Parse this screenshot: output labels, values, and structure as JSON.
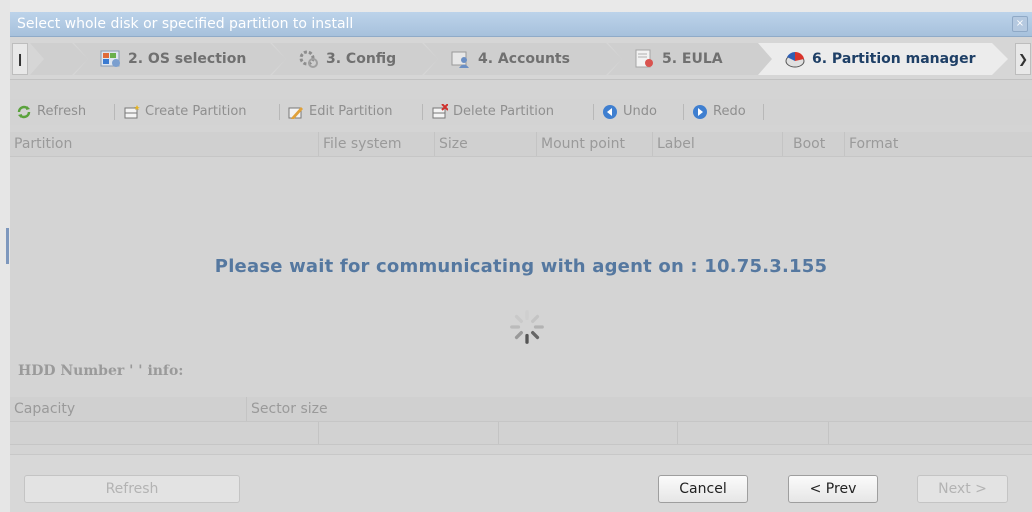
{
  "dialog": {
    "title": "Select whole disk or specified partition to install",
    "close_label": "×"
  },
  "steps": [
    {
      "label": "2. OS selection",
      "icon": "os-selection-icon",
      "active": false
    },
    {
      "label": "3. Config",
      "icon": "config-gear-icon",
      "active": false
    },
    {
      "label": "4. Accounts",
      "icon": "accounts-icon",
      "active": false
    },
    {
      "label": "5. EULA",
      "icon": "eula-certificate-icon",
      "active": false
    },
    {
      "label": "6. Partition manager",
      "icon": "partition-disk-icon",
      "active": true
    }
  ],
  "steps_partial_label": "",
  "toolbar": {
    "refresh": "Refresh",
    "create": "Create Partition",
    "edit": "Edit Partition",
    "delete": "Delete Partition",
    "undo": "Undo",
    "redo": "Redo"
  },
  "grid": {
    "columns": [
      "Partition",
      "File system",
      "Size",
      "Mount point",
      "Label",
      "Boot",
      "Format"
    ]
  },
  "wait_message": "Please wait for communicating with agent on :  10.75.3.155",
  "hdd_info_label": "HDD Number '   ' info:",
  "hdd_columns": [
    "Capacity",
    "Sector size"
  ],
  "buttons": {
    "refresh": "Refresh",
    "cancel": "Cancel",
    "prev": "< Prev",
    "next": "Next >"
  },
  "colors": {
    "active_step_text": "#1e3f66",
    "wait_text": "#5578a0",
    "titlebar": "#a7c1dc"
  }
}
